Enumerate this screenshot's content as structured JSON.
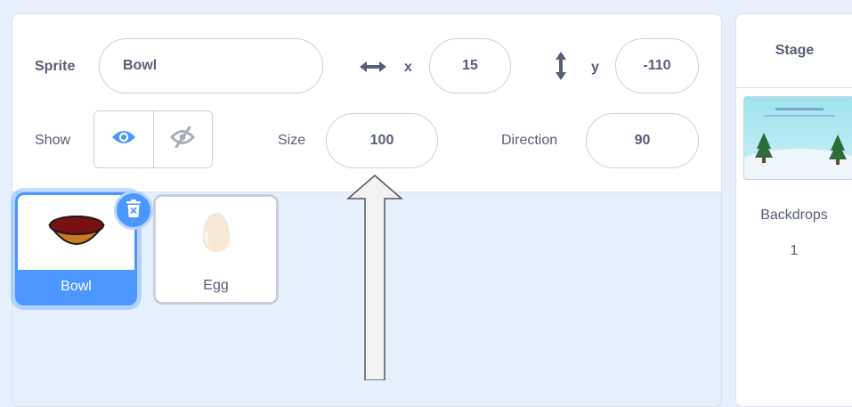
{
  "sprite_info": {
    "sprite_label": "Sprite",
    "sprite_name": "Bowl",
    "x_label": "x",
    "x_value": "15",
    "y_label": "y",
    "y_value": "-110",
    "show_label": "Show",
    "size_label": "Size",
    "size_value": "100",
    "direction_label": "Direction",
    "direction_value": "90"
  },
  "sprites": [
    {
      "name": "Bowl",
      "selected": true,
      "icon": "bowl-icon"
    },
    {
      "name": "Egg",
      "selected": false,
      "icon": "egg-icon"
    }
  ],
  "stage": {
    "title": "Stage",
    "backdrops_label": "Backdrops",
    "backdrops_count": "1"
  },
  "colors": {
    "accent": "#4c97ff",
    "text": "#575e75",
    "background": "#e6f0fd"
  }
}
